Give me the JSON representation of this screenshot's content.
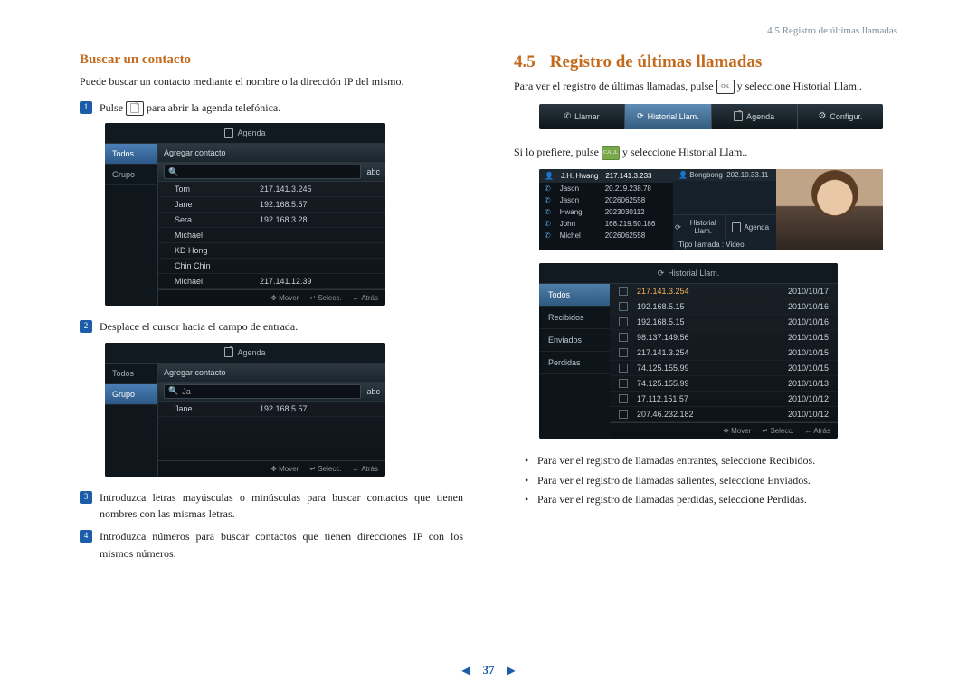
{
  "breadcrumb": "4.5 Registro de últimas llamadas",
  "left": {
    "subheading": "Buscar un contacto",
    "intro": "Puede buscar un contacto mediante el nombre o la dirección IP del mismo.",
    "step1_a": "Pulse ",
    "step1_b": " para abrir la agenda telefónica.",
    "step2": "Desplace el cursor hacia el campo de entrada.",
    "step3": "Introduzca letras mayúsculas o minúsculas para buscar contactos que tienen nombres con las mismas letras.",
    "step4": "Introduzca números para buscar contactos que tienen direcciones IP con los mismos números.",
    "icon_book": "book-icon"
  },
  "shot1": {
    "title": "Agenda",
    "side": [
      "Todos",
      "Grupo"
    ],
    "side_selected": 0,
    "add": "Agregar contacto",
    "mode": "abc",
    "search": "",
    "rows": [
      {
        "name": "Tom",
        "ip": "217.141.3.245"
      },
      {
        "name": "Jane",
        "ip": "192.168.5.57"
      },
      {
        "name": "Sera",
        "ip": "192.168.3.28"
      },
      {
        "name": "Michael",
        "ip": ""
      },
      {
        "name": "KD Hong",
        "ip": ""
      },
      {
        "name": "Chin Chin",
        "ip": ""
      },
      {
        "name": "Michael",
        "ip": "217.141.12.39"
      }
    ],
    "hints": [
      "Mover",
      "Selecc.",
      "Atrás"
    ]
  },
  "shot2": {
    "title": "Agenda",
    "side": [
      "Todos",
      "Grupo"
    ],
    "side_selected": 1,
    "add": "Agregar contacto",
    "mode": "abc",
    "search": "Ja",
    "rows": [
      {
        "name": "Jane",
        "ip": "192.168.5.57"
      }
    ],
    "hints": [
      "Mover",
      "Selecc.",
      "Atrás"
    ]
  },
  "right": {
    "num": "4.5",
    "title": "Registro de últimas llamadas",
    "p1_a": "Para ver el registro de últimas llamadas, pulse ",
    "p1_b": " y seleccione Historial Llam..",
    "icon_ok": "OK",
    "p2_a": "Si lo prefiere, pulse ",
    "p2_b": " y seleccione Historial Llam..",
    "icon_call": "CALL",
    "bullets": [
      "Para ver el registro de llamadas entrantes, seleccione Recibidos.",
      "Para ver el registro de llamadas salientes, seleccione Enviados.",
      "Para ver el registro de llamadas perdidas, seleccione Perdidas."
    ]
  },
  "menubar": {
    "items": [
      "Llamar",
      "Historial Llam.",
      "Agenda",
      "Configur."
    ],
    "selected": 1
  },
  "callshot": {
    "header_name": "J.H. Hwang",
    "header_ip": "217.141.3.233",
    "peer_name": "Bongbong",
    "peer_ip": "202.10.33.11",
    "rows": [
      {
        "n": "Jason",
        "v": "20.219.238.78"
      },
      {
        "n": "Jason",
        "v": "2026062558"
      },
      {
        "n": "Hwang",
        "v": "2023030112"
      },
      {
        "n": "John",
        "v": "168.219.50.186"
      },
      {
        "n": "Michel",
        "v": "2026062558"
      }
    ],
    "btns": [
      "Historial Llam.",
      "Agenda"
    ],
    "calltype": "Tipo llamada : Video"
  },
  "hist": {
    "title": "Historial Llam.",
    "side": [
      "Todos",
      "Recibidos",
      "Enviados",
      "Perdidas"
    ],
    "side_selected": 0,
    "rows": [
      {
        "ip": "217.141.3.254",
        "d": "2010/10/17",
        "sel": true
      },
      {
        "ip": "192.168.5.15",
        "d": "2010/10/16"
      },
      {
        "ip": "192.168.5.15",
        "d": "2010/10/16"
      },
      {
        "ip": "98.137.149.56",
        "d": "2010/10/15"
      },
      {
        "ip": "217.141.3.254",
        "d": "2010/10/15"
      },
      {
        "ip": "74.125.155.99",
        "d": "2010/10/15"
      },
      {
        "ip": "74.125.155.99",
        "d": "2010/10/13"
      },
      {
        "ip": "17.112.151.57",
        "d": "2010/10/12"
      },
      {
        "ip": "207.46.232.182",
        "d": "2010/10/12"
      }
    ],
    "hints": [
      "Mover",
      "Selecc.",
      "Atrás"
    ]
  },
  "page_number": "37"
}
